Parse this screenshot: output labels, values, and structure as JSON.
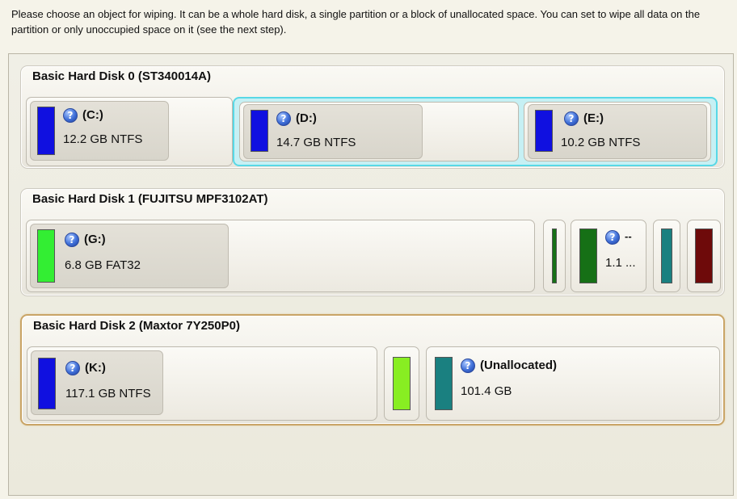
{
  "instructions": "Please choose an object for wiping. It can be a whole hard disk, a single partition or a block of unallocated space. You can set to wipe all data on the partition or only unoccupied space on it (see the next step).",
  "colors": {
    "ntfs": "#1010e0",
    "fat32": "#33ee33",
    "extended_outline": "#58d8e6",
    "selected_outline": "#c9a466",
    "dark_green": "#167016",
    "teal": "#1a8080",
    "maroon": "#6e0a0a",
    "lime": "#88ee22"
  },
  "disks": [
    {
      "title": "Basic Hard Disk 0 (ST340014A)",
      "partitions": [
        {
          "name": "(C:)",
          "info": "12.2 GB NTFS",
          "icon": "question-icon"
        },
        {
          "name": "(D:)",
          "info": "14.7 GB NTFS",
          "icon": "question-icon"
        },
        {
          "name": "(E:)",
          "info": "10.2 GB NTFS",
          "icon": "question-icon"
        }
      ]
    },
    {
      "title": "Basic Hard Disk 1 (FUJITSU MPF3102AT)",
      "partitions": [
        {
          "name": "(G:)",
          "info": "6.8 GB FAT32",
          "icon": "question-icon"
        },
        {
          "name": "--",
          "info": "1.1 ...",
          "icon": "question-icon"
        }
      ]
    },
    {
      "title": "Basic Hard Disk 2 (Maxtor 7Y250P0)",
      "partitions": [
        {
          "name": "(K:)",
          "info": "117.1 GB NTFS",
          "icon": "question-icon"
        },
        {
          "name": "(Unallocated)",
          "info": "101.4 GB",
          "icon": "question-icon"
        }
      ]
    }
  ],
  "icon_glyph": "?"
}
